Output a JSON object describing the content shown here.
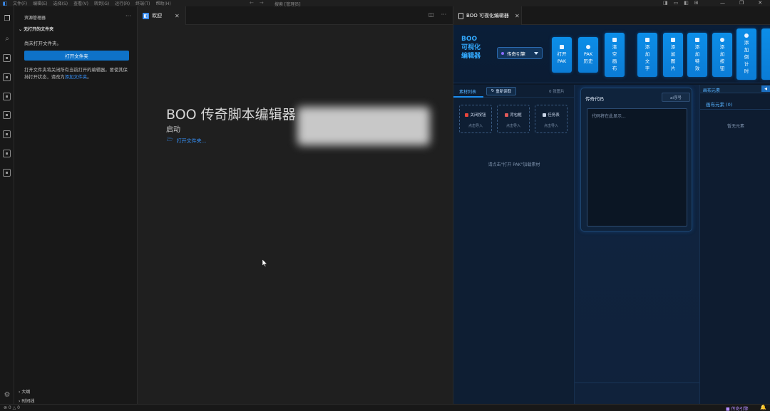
{
  "titlebar": {
    "menu": [
      "文件(F)",
      "编辑(E)",
      "选择(S)",
      "查看(V)",
      "转到(G)",
      "运行(R)",
      "终端(T)",
      "帮助(H)"
    ],
    "search": "搜索 [管理员]",
    "nav_back": "←",
    "nav_forward": "→"
  },
  "sidebar": {
    "header": "资源管理器",
    "more": "···",
    "section": "无打开的文件夹",
    "no_folder_msg": "尚未打开文件夹。",
    "open_folder_button": "打开文件夹",
    "info_text": "打开文件夹将关闭所有当前打开的编辑器。要使其保持打开状态，请改为",
    "info_link": "添加文件夹",
    "info_end": "。",
    "outline": "大纲",
    "timeline": "时间线"
  },
  "editor1": {
    "tab_label": "欢迎",
    "welcome_title": "BOO 传奇脚本编辑器",
    "start_heading": "启动",
    "open_folder_link": "打开文件夹..."
  },
  "editor2": {
    "tab_label": "BOO 可视化编辑器",
    "brand": "BOO 可视化编辑器",
    "engine_select": "传奇引擎",
    "toolbar_buttons": [
      {
        "label": "打开PAK"
      },
      {
        "label": "PAK历史"
      },
      {
        "label": "清空画布"
      },
      {
        "label": "添加文字"
      },
      {
        "label": "添加图片"
      },
      {
        "label": "添加特效"
      },
      {
        "label": "添加按钮"
      },
      {
        "label": "添加倒计时"
      }
    ],
    "left_tab": "素材列表",
    "refresh_button": "重新读取",
    "asset_count": "0 张图片",
    "assets": [
      {
        "label": "关闭按钮",
        "sub": "点击导入",
        "color": "#e8453c"
      },
      {
        "label": "背包框",
        "sub": "点击导入",
        "color": "#e05a5a"
      },
      {
        "label": "任务表",
        "sub": "点击导入",
        "color": "#c8d4e6"
      }
    ],
    "left_hint": "请点击\"打开 PAK\"加载素材",
    "code_title": "传奇代码",
    "code_button": "ai序号",
    "code_placeholder": "代码将在此显示...",
    "right_header": "画布元素",
    "right_collapse": "◀",
    "right_sub": "画布元素 (0)",
    "right_empty": "暂无元素"
  },
  "statusbar": {
    "errors": "⊗ 0 △ 0",
    "right_text": "■ 传奇引擎"
  },
  "colors": {
    "accent": "#0e72c8",
    "webview_bg": "#0c1726",
    "toolbar_button": "#0c8ee8",
    "brand_text": "#33aaff"
  }
}
